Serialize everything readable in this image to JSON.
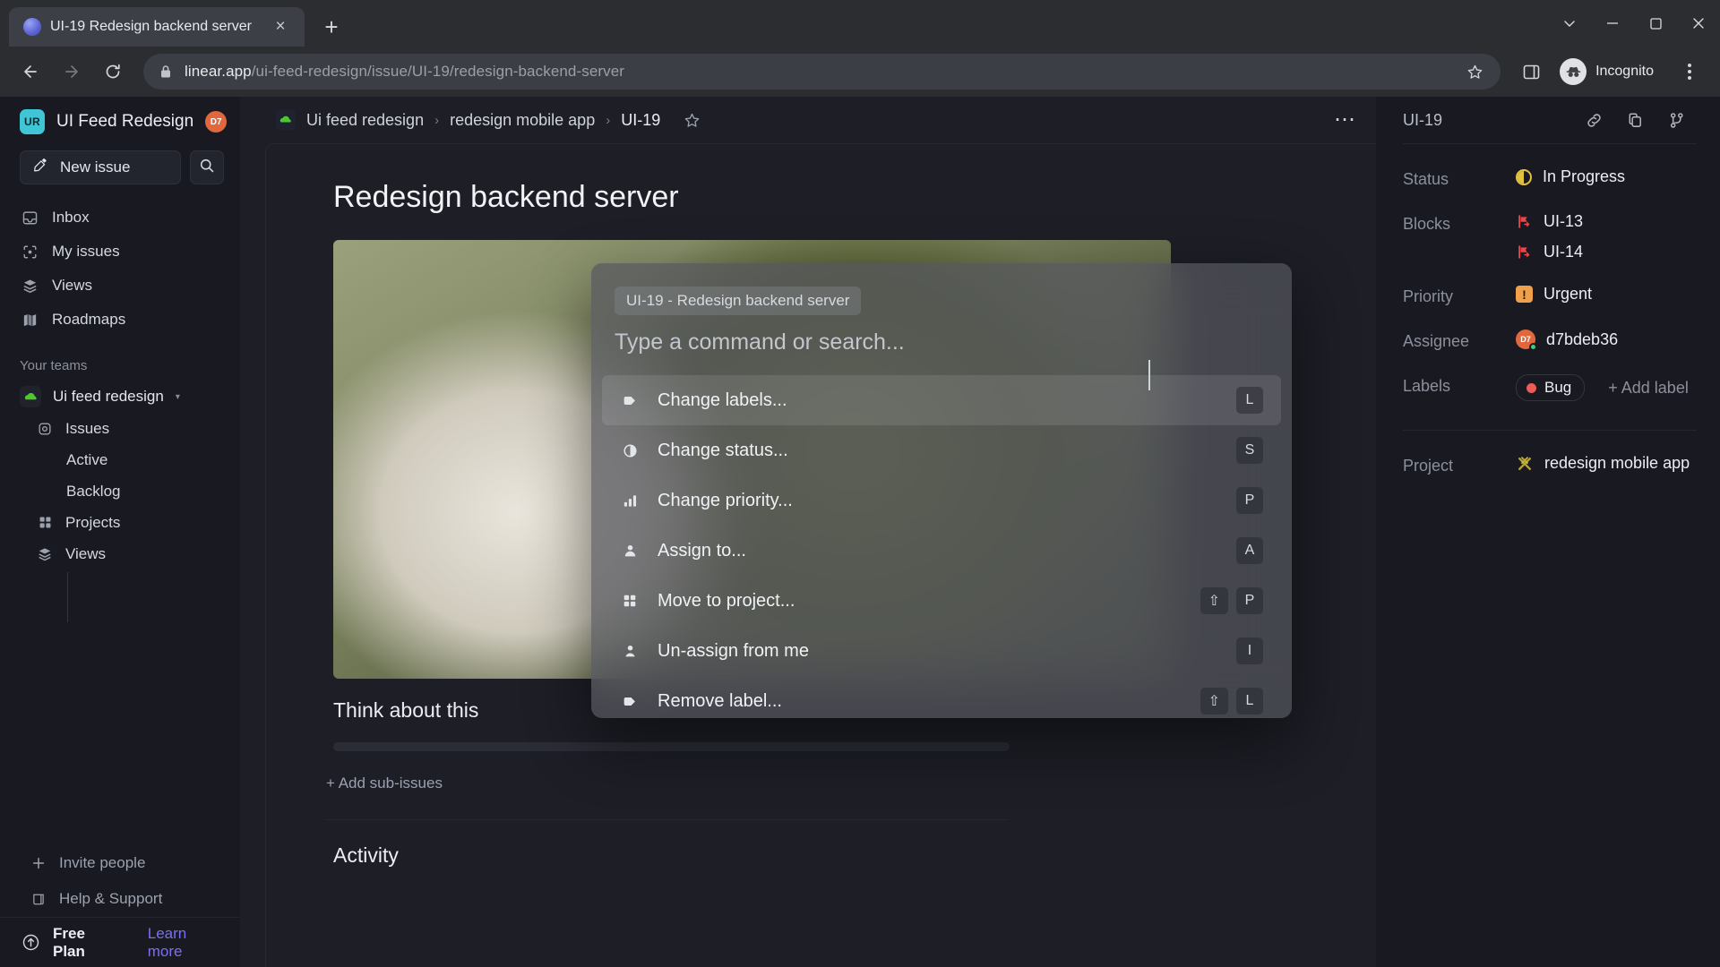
{
  "browser": {
    "tab": {
      "title": "UI-19 Redesign backend server",
      "close_label": "×",
      "favicon": "linear-favicon"
    },
    "new_tab_label": "+",
    "window_controls": {
      "minimize": "–",
      "maximize": "□",
      "close": "×",
      "chevron": "⌄"
    },
    "url": {
      "domain": "linear.app",
      "path": "/ui-feed-redesign/issue/UI-19/redesign-backend-server"
    },
    "profile_label": "Incognito"
  },
  "sidebar": {
    "workspace": {
      "initials": "UR",
      "name": "UI Feed Redesign",
      "avatar_initials": "D7"
    },
    "new_issue_label": "New issue",
    "nav": [
      {
        "label": "Inbox",
        "icon": "inbox-icon"
      },
      {
        "label": "My issues",
        "icon": "my-issues-icon"
      },
      {
        "label": "Views",
        "icon": "views-icon"
      },
      {
        "label": "Roadmaps",
        "icon": "roadmaps-icon"
      }
    ],
    "teams_heading": "Your teams",
    "team": {
      "name": "Ui feed redesign",
      "caret": "▾"
    },
    "team_nav": [
      {
        "label": "Issues",
        "icon": "issues-icon"
      },
      {
        "label": "Projects",
        "icon": "projects-icon"
      },
      {
        "label": "Views",
        "icon": "views-icon"
      }
    ],
    "team_leaves": [
      {
        "label": "Active"
      },
      {
        "label": "Backlog"
      }
    ],
    "footer": [
      {
        "label": "Invite people",
        "icon": "plus-icon"
      },
      {
        "label": "Help & Support",
        "icon": "book-icon"
      }
    ],
    "plan": {
      "name": "Free Plan",
      "link": "Learn more"
    }
  },
  "main": {
    "breadcrumb": {
      "team": "Ui feed redesign",
      "project": "redesign mobile app",
      "issue": "UI-19",
      "separator": "›"
    },
    "issue_title": "Redesign backend server",
    "section_heading": "Think about this",
    "add_sub_issues": "+ Add sub-issues",
    "activity_heading": "Activity"
  },
  "palette": {
    "context_chip": "UI-19 - Redesign backend server",
    "placeholder": "Type a command or search...",
    "items": [
      {
        "label": "Change labels...",
        "icon": "tag-icon",
        "keys": [
          "L"
        ],
        "active": true
      },
      {
        "label": "Change status...",
        "icon": "status-icon",
        "keys": [
          "S"
        ],
        "active": false
      },
      {
        "label": "Change priority...",
        "icon": "priority-icon",
        "keys": [
          "P"
        ],
        "active": false
      },
      {
        "label": "Assign to...",
        "icon": "assign-icon",
        "keys": [
          "A"
        ],
        "active": false
      },
      {
        "label": "Move to project...",
        "icon": "project-icon",
        "keys": [
          "⇧",
          "P"
        ],
        "active": false
      },
      {
        "label": "Un-assign from me",
        "icon": "unassign-icon",
        "keys": [
          "I"
        ],
        "active": false
      },
      {
        "label": "Remove label...",
        "icon": "tag-icon",
        "keys": [
          "⇧",
          "L"
        ],
        "active": false
      }
    ]
  },
  "right_panel": {
    "issue_id": "UI-19",
    "header_icons": [
      "link-icon",
      "copy-icon",
      "branch-icon"
    ],
    "properties": {
      "status": {
        "label": "Status",
        "value": "In Progress"
      },
      "blocks": {
        "label": "Blocks",
        "values": [
          "UI-13",
          "UI-14"
        ]
      },
      "priority": {
        "label": "Priority",
        "value": "Urgent",
        "badge": "!"
      },
      "assignee": {
        "label": "Assignee",
        "value": "d7bdeb36",
        "initials": "D7"
      },
      "labels": {
        "label": "Labels",
        "chip": "Bug",
        "add": "+ Add label"
      },
      "project": {
        "label": "Project",
        "value": "redesign mobile app"
      }
    }
  },
  "colors": {
    "accent": "#7b6ef0",
    "status_in_progress": "#e2c23f",
    "priority_urgent": "#f0a04b",
    "label_bug": "#ee5b56",
    "blocks_red": "#e8484c",
    "online": "#38d07f"
  }
}
